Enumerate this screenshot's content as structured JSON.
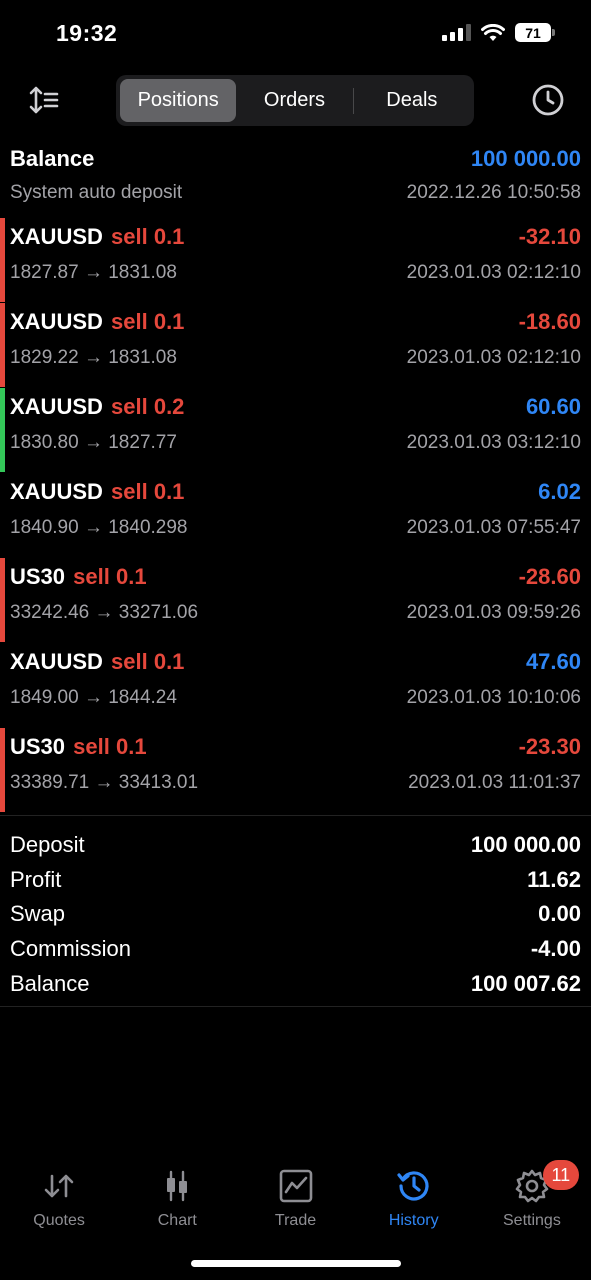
{
  "status": {
    "time": "19:32",
    "battery": "71"
  },
  "segments": [
    {
      "label": "Positions",
      "active": true
    },
    {
      "label": "Orders",
      "active": false
    },
    {
      "label": "Deals",
      "active": false
    }
  ],
  "balance_row": {
    "title": "Balance",
    "amount": "100 000.00",
    "subtitle": "System auto deposit",
    "timestamp": "2022.12.26 10:50:58"
  },
  "positions": [
    {
      "symbol": "XAUUSD",
      "side": "sell 0.1",
      "profit": "-32.10",
      "prices": "1827.87 → 1831.08",
      "time": "2023.01.03 02:12:10",
      "bar": "#e5483c",
      "profit_color": "red"
    },
    {
      "symbol": "XAUUSD",
      "side": "sell 0.1",
      "profit": "-18.60",
      "prices": "1829.22 → 1831.08",
      "time": "2023.01.03 02:12:10",
      "bar": "#e5483c",
      "profit_color": "red"
    },
    {
      "symbol": "XAUUSD",
      "side": "sell 0.2",
      "profit": "60.60",
      "prices": "1830.80 → 1827.77",
      "time": "2023.01.03 03:12:10",
      "bar": "#34c759",
      "profit_color": "blue"
    },
    {
      "symbol": "XAUUSD",
      "side": "sell 0.1",
      "profit": "6.02",
      "prices": "1840.90 → 1840.298",
      "time": "2023.01.03 07:55:47",
      "bar": "",
      "profit_color": "blue"
    },
    {
      "symbol": "US30",
      "side": "sell 0.1",
      "profit": "-28.60",
      "prices": "33242.46 → 33271.06",
      "time": "2023.01.03 09:59:26",
      "bar": "#e5483c",
      "profit_color": "red"
    },
    {
      "symbol": "XAUUSD",
      "side": "sell 0.1",
      "profit": "47.60",
      "prices": "1849.00 → 1844.24",
      "time": "2023.01.03 10:10:06",
      "bar": "",
      "profit_color": "blue"
    },
    {
      "symbol": "US30",
      "side": "sell 0.1",
      "profit": "-23.30",
      "prices": "33389.71 → 33413.01",
      "time": "2023.01.03 11:01:37",
      "bar": "#e5483c",
      "profit_color": "red"
    }
  ],
  "summary": [
    {
      "key": "Deposit",
      "value": "100 000.00"
    },
    {
      "key": "Profit",
      "value": "11.62"
    },
    {
      "key": "Swap",
      "value": "0.00"
    },
    {
      "key": "Commission",
      "value": "-4.00"
    },
    {
      "key": "Balance",
      "value": "100 007.62"
    }
  ],
  "tabs": [
    {
      "label": "Quotes",
      "icon": "quotes-icon",
      "active": false
    },
    {
      "label": "Chart",
      "icon": "chart-icon",
      "active": false
    },
    {
      "label": "Trade",
      "icon": "trade-icon",
      "active": false
    },
    {
      "label": "History",
      "icon": "history-icon",
      "active": true
    },
    {
      "label": "Settings",
      "icon": "settings-icon",
      "active": false,
      "badge": "11"
    }
  ],
  "colors": {
    "red": "#e5483c",
    "blue": "#2f86f5",
    "green": "#34c759",
    "muted": "#a3a3a8"
  }
}
